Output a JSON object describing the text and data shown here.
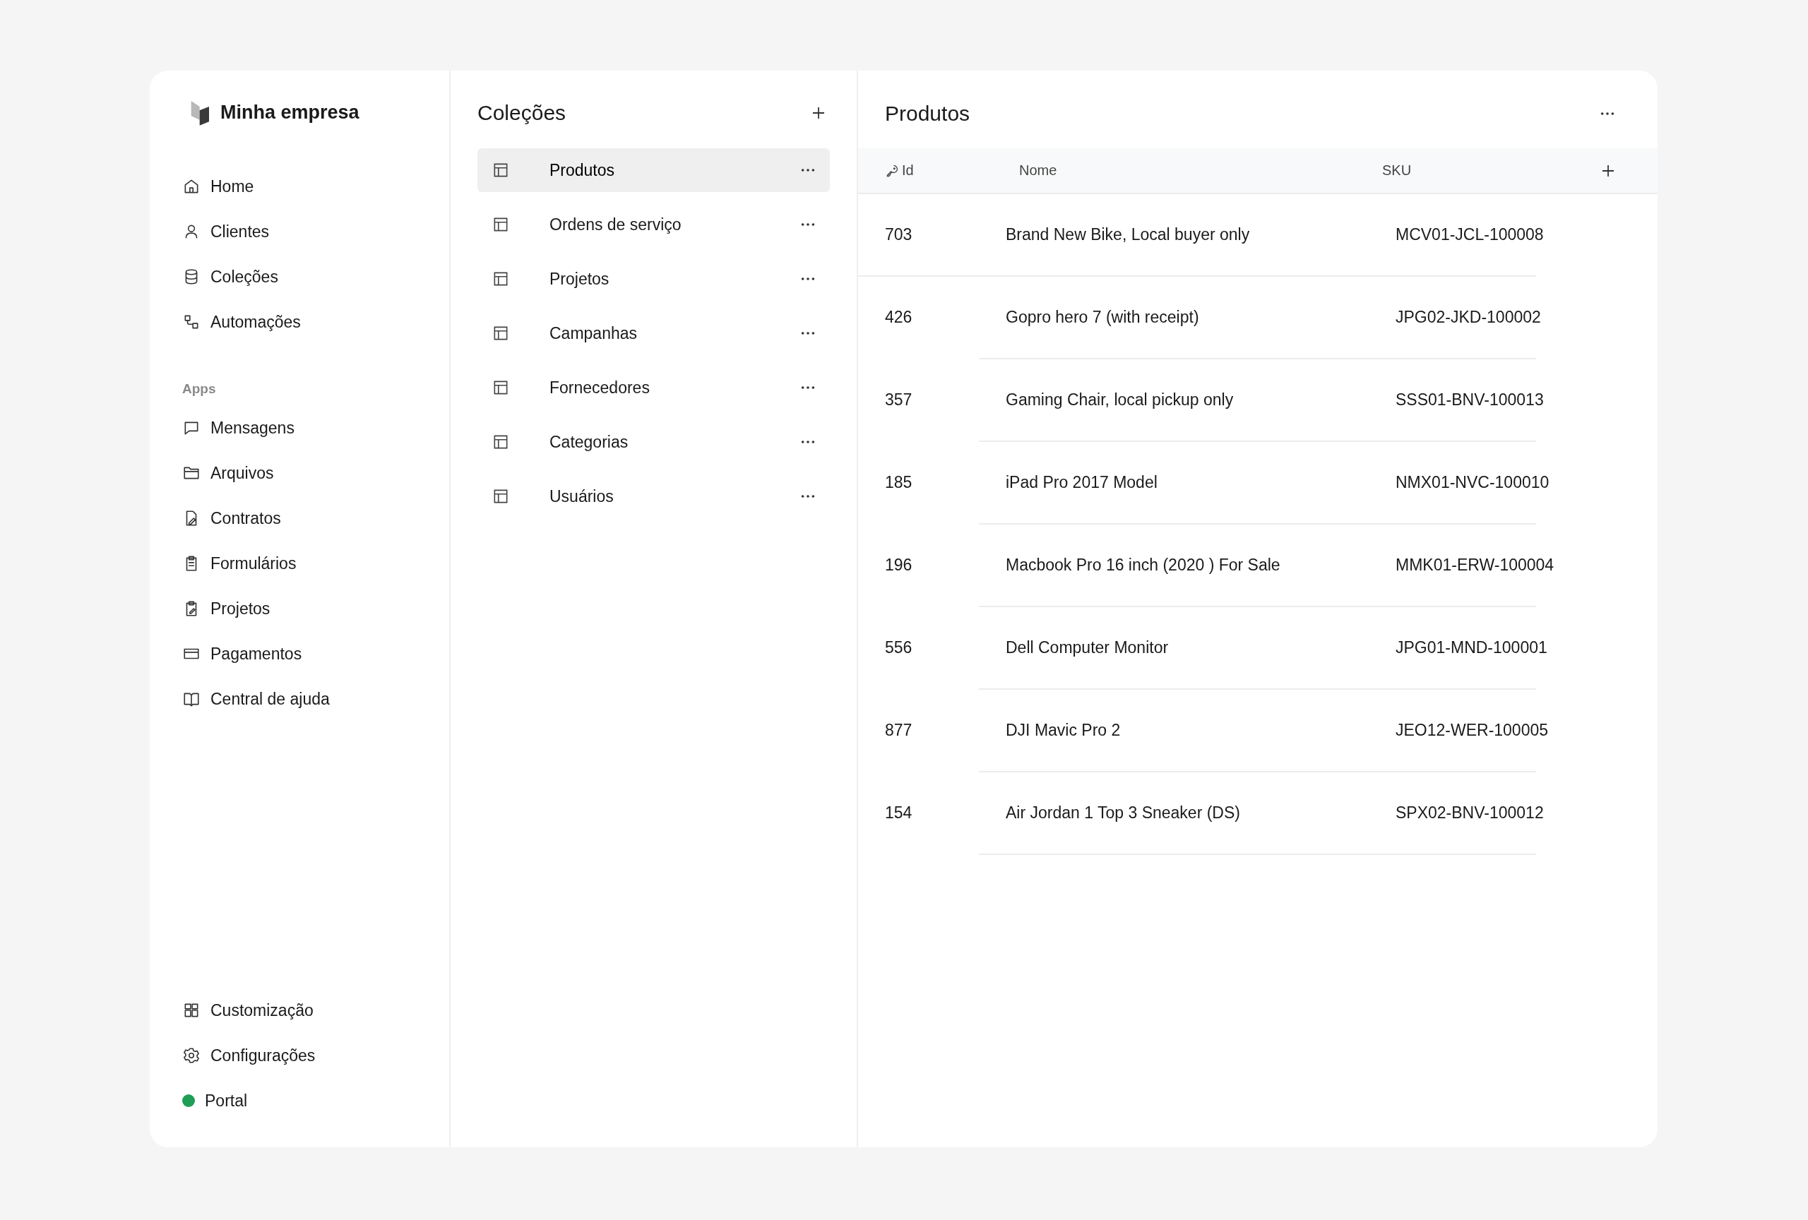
{
  "brand": {
    "name": "Minha empresa"
  },
  "sidebar": {
    "main_items": [
      {
        "label": "Home"
      },
      {
        "label": "Clientes"
      },
      {
        "label": "Coleções"
      },
      {
        "label": "Automações"
      }
    ],
    "apps_heading": "Apps",
    "app_items": [
      {
        "label": "Mensagens"
      },
      {
        "label": "Arquivos"
      },
      {
        "label": "Contratos"
      },
      {
        "label": "Formulários"
      },
      {
        "label": "Projetos"
      },
      {
        "label": "Pagamentos"
      },
      {
        "label": "Central de ajuda"
      }
    ],
    "bottom_items": [
      {
        "label": "Customização"
      },
      {
        "label": "Configurações"
      }
    ],
    "portal": {
      "label": "Portal",
      "color": "#1f9d55"
    }
  },
  "collections": {
    "title": "Coleções",
    "items": [
      {
        "label": "Produtos",
        "selected": true
      },
      {
        "label": "Ordens de serviço",
        "selected": false
      },
      {
        "label": "Projetos",
        "selected": false
      },
      {
        "label": "Campanhas",
        "selected": false
      },
      {
        "label": "Fornecedores",
        "selected": false
      },
      {
        "label": "Categorias",
        "selected": false
      },
      {
        "label": "Usuários",
        "selected": false
      }
    ]
  },
  "table": {
    "title": "Produtos",
    "columns": [
      "Id",
      "Nome",
      "SKU"
    ],
    "rows": [
      {
        "id": "703",
        "name": "Brand New Bike, Local buyer only",
        "sku": "MCV01-JCL-100008"
      },
      {
        "id": "426",
        "name": "Gopro hero 7 (with receipt)",
        "sku": "JPG02-JKD-100002"
      },
      {
        "id": "357",
        "name": "Gaming Chair, local pickup only",
        "sku": "SSS01-BNV-100013"
      },
      {
        "id": "185",
        "name": "iPad Pro 2017 Model",
        "sku": "NMX01-NVC-100010"
      },
      {
        "id": "196",
        "name": "Macbook Pro 16 inch (2020 ) For Sale",
        "sku": "MMK01-ERW-100004"
      },
      {
        "id": "556",
        "name": "Dell Computer Monitor",
        "sku": "JPG01-MND-100001"
      },
      {
        "id": "877",
        "name": "DJI Mavic Pro 2",
        "sku": "JEO12-WER-100005"
      },
      {
        "id": "154",
        "name": "Air Jordan 1 Top 3 Sneaker (DS)",
        "sku": "SPX02-BNV-100012"
      }
    ]
  }
}
